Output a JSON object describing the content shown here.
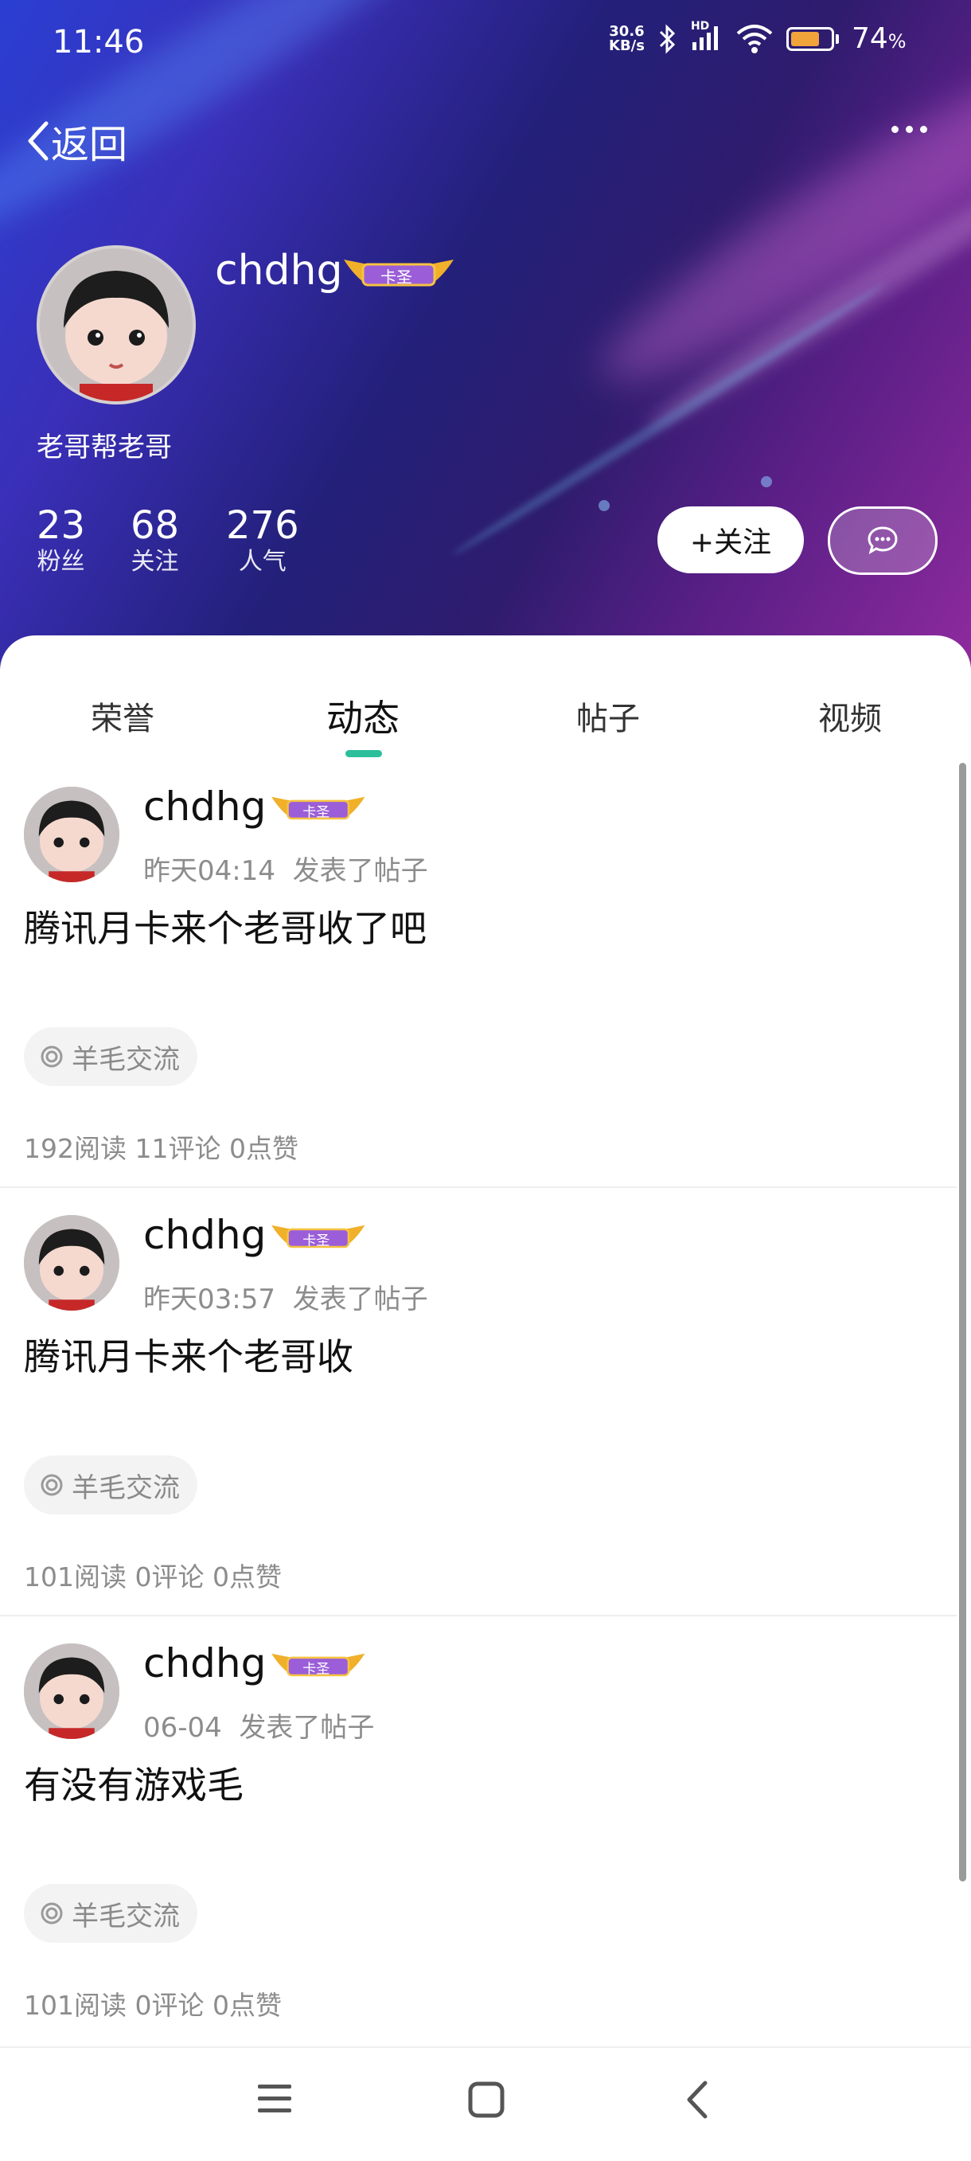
{
  "status_bar": {
    "time": "11:46",
    "net_speed_value": "30.6",
    "net_speed_unit": "KB/s",
    "signal_label": "HD",
    "battery_percent": "74",
    "battery_unit": "%",
    "battery_level": 0.74,
    "battery_color": "#f0a43a"
  },
  "nav": {
    "back_label": "返回"
  },
  "profile": {
    "username": "chdhg",
    "badge_text": "卡圣",
    "bio": "老哥帮老哥",
    "stats": [
      {
        "value": "23",
        "label": "粉丝"
      },
      {
        "value": "68",
        "label": "关注"
      },
      {
        "value": "276",
        "label": "人气"
      }
    ],
    "follow_label": "+关注"
  },
  "tabs": [
    {
      "label": "荣誉",
      "active": false
    },
    {
      "label": "动态",
      "active": true
    },
    {
      "label": "帖子",
      "active": false
    },
    {
      "label": "视频",
      "active": false
    }
  ],
  "accent_color": "#2bbf9b",
  "posts": [
    {
      "author": "chdhg",
      "badge": "卡圣",
      "time": "昨天04:14",
      "action": "发表了帖子",
      "text": "腾讯月卡来个老哥收了吧",
      "tag": "羊毛交流",
      "stats": "192阅读 11评论 0点赞"
    },
    {
      "author": "chdhg",
      "badge": "卡圣",
      "time": "昨天03:57",
      "action": "发表了帖子",
      "text": "腾讯月卡来个老哥收",
      "tag": "羊毛交流",
      "stats": "101阅读 0评论 0点赞"
    },
    {
      "author": "chdhg",
      "badge": "卡圣",
      "time": "06-04",
      "action": "发表了帖子",
      "text": "有没有游戏毛",
      "tag": "羊毛交流",
      "stats": "101阅读 0评论 0点赞"
    }
  ]
}
